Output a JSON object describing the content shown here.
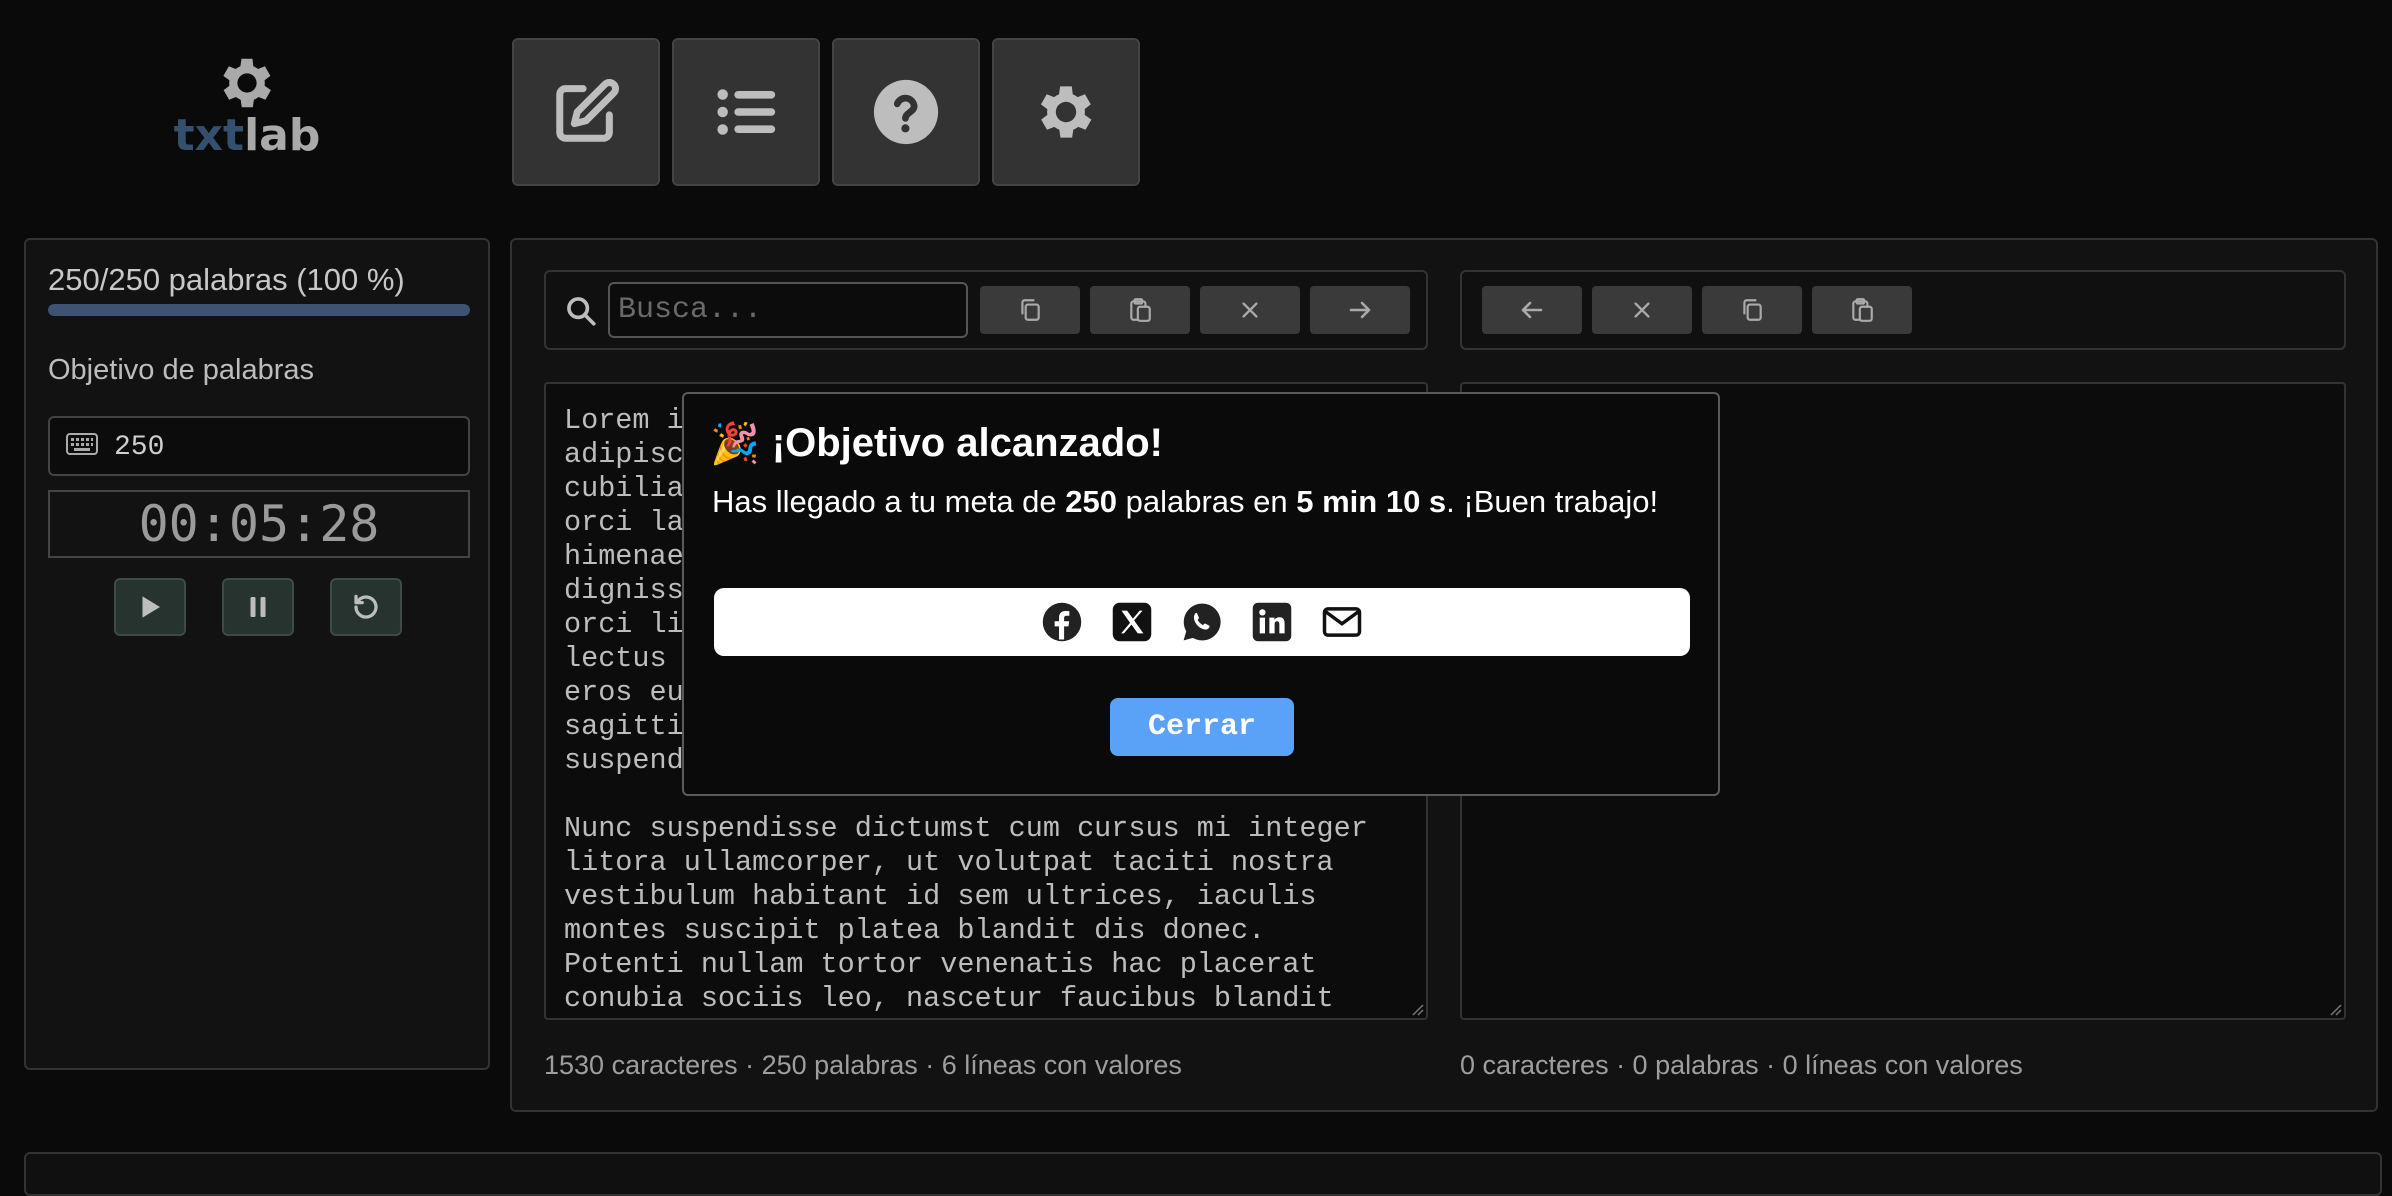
{
  "logo": {
    "part1": "txt",
    "part2": "lab"
  },
  "nav": [
    {
      "icon": "edit-icon",
      "label": ""
    },
    {
      "icon": "list-icon",
      "label": ""
    },
    {
      "icon": "help-icon",
      "label": ""
    },
    {
      "icon": "settings-icon",
      "label": ""
    }
  ],
  "sidebar": {
    "progress_text": "250/250 palabras (100 %)",
    "progress_fraction": 1.0,
    "goal_label": "Objetivo de palabras",
    "goal_value": "250",
    "timer": "00:05:28",
    "controls": [
      "play-icon",
      "pause-icon",
      "reset-icon"
    ]
  },
  "left_editor": {
    "search_placeholder": "Busca...",
    "toolbar": [
      "copy-icon",
      "paste-icon",
      "clear-icon",
      "arrow-right-icon"
    ],
    "lines_before_modal": [
      "Lorem i",
      "adipisc",
      "cubilia",
      "orci la",
      "himenae",
      "digniss",
      "orci li",
      "lectus",
      "eros eu",
      "sagitti",
      "suspend"
    ],
    "paragraph2": "Nunc suspendisse dictumst cum cursus mi integer\nlitora ullamcorper, ut volutpat taciti nostra\nvestibulum habitant id sem ultrices, iaculis\nmontes suscipit platea blandit dis donec.\nPotenti nullam tortor venenatis hac placerat\nconubia sociis leo, nascetur faucibus blandit",
    "stats": "1530 caracteres · 250 palabras · 6 líneas con valores"
  },
  "right_editor": {
    "toolbar": [
      "arrow-left-icon",
      "clear-icon",
      "copy-icon",
      "paste-icon"
    ],
    "stats": "0 caracteres · 0 palabras · 0 líneas con valores"
  },
  "modal": {
    "emoji": "🎉",
    "title": "¡Objetivo alcanzado!",
    "msg_pre": "Has llegado a tu meta de ",
    "msg_words": "250",
    "msg_mid": " palabras en ",
    "msg_time": "5 min 10 s",
    "msg_post": ". ¡Buen trabajo!",
    "share": [
      "facebook-icon",
      "x-icon",
      "whatsapp-icon",
      "linkedin-icon",
      "email-icon"
    ],
    "close_label": "Cerrar"
  },
  "colors": {
    "accent": "#5aa2f8",
    "progress": "#3d5373",
    "logo_primary": "#35506e"
  }
}
